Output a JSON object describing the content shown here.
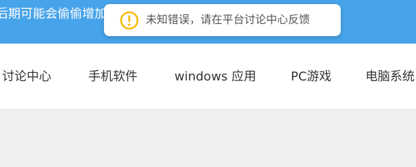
{
  "banner": {
    "text": "后期可能会偷偷增加一些新的功能，遇到问题请及时反馈窝"
  },
  "nav": {
    "items": [
      {
        "label": "讨论中心"
      },
      {
        "label": "手机软件"
      },
      {
        "label": "windows 应用"
      },
      {
        "label": "PC游戏"
      },
      {
        "label": "电脑系统"
      }
    ]
  },
  "toast": {
    "icon": "warning-circle-icon",
    "message": "未知错误，请在平台讨论中心反馈",
    "color": "#f5b800"
  },
  "colors": {
    "banner_bg": "#48a4ea",
    "nav_bg": "#ffffff",
    "page_bg": "#efefef"
  }
}
